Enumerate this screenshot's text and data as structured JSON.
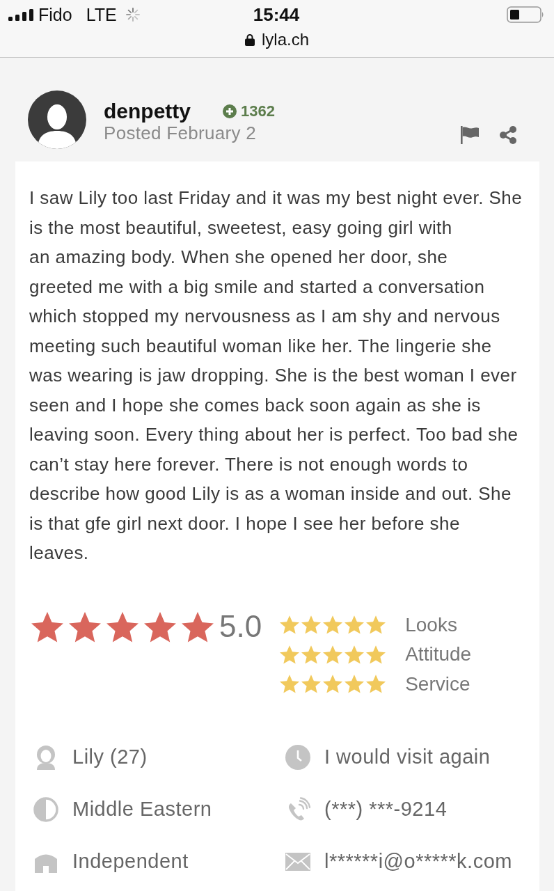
{
  "status_bar": {
    "carrier": "Fido",
    "network": "LTE",
    "time": "15:44",
    "url": "lyla.ch"
  },
  "post": {
    "author": "denpetty",
    "points": "1362",
    "posted": "Posted February 2"
  },
  "review": {
    "text": "I saw Lily too last Friday and it was my best night ever. She is the most beautiful, sweetest, easy going girl with\nan amazing body. When she opened her door, she\ngreeted me with a big smile and started a conversation which stopped my nervousness as I am shy and nervous meeting such beautiful woman like her. The lingerie she was wearing is jaw dropping. She is the best woman I ever seen and I hope she comes back soon again as she is leaving soon. Every thing about her is perfect. Too bad she can’t stay here forever. There is not enough words to describe how good Lily is as a woman inside and out. She is that gfe girl next door. I hope I see her before she leaves."
  },
  "rating": {
    "stars": 5,
    "score": "5.0",
    "categories": [
      {
        "label": "Looks",
        "stars": 5
      },
      {
        "label": "Attitude",
        "stars": 5
      },
      {
        "label": "Service",
        "stars": 5
      }
    ]
  },
  "details": [
    {
      "kind": "person",
      "text": "Lily (27)"
    },
    {
      "kind": "clock",
      "text": "I would visit again"
    },
    {
      "kind": "contrast",
      "text": "Middle Eastern"
    },
    {
      "kind": "phone",
      "text": "(***) ***-9214"
    },
    {
      "kind": "house",
      "text": "Independent"
    },
    {
      "kind": "envelope",
      "text": "l******i@o*****k.com"
    }
  ]
}
